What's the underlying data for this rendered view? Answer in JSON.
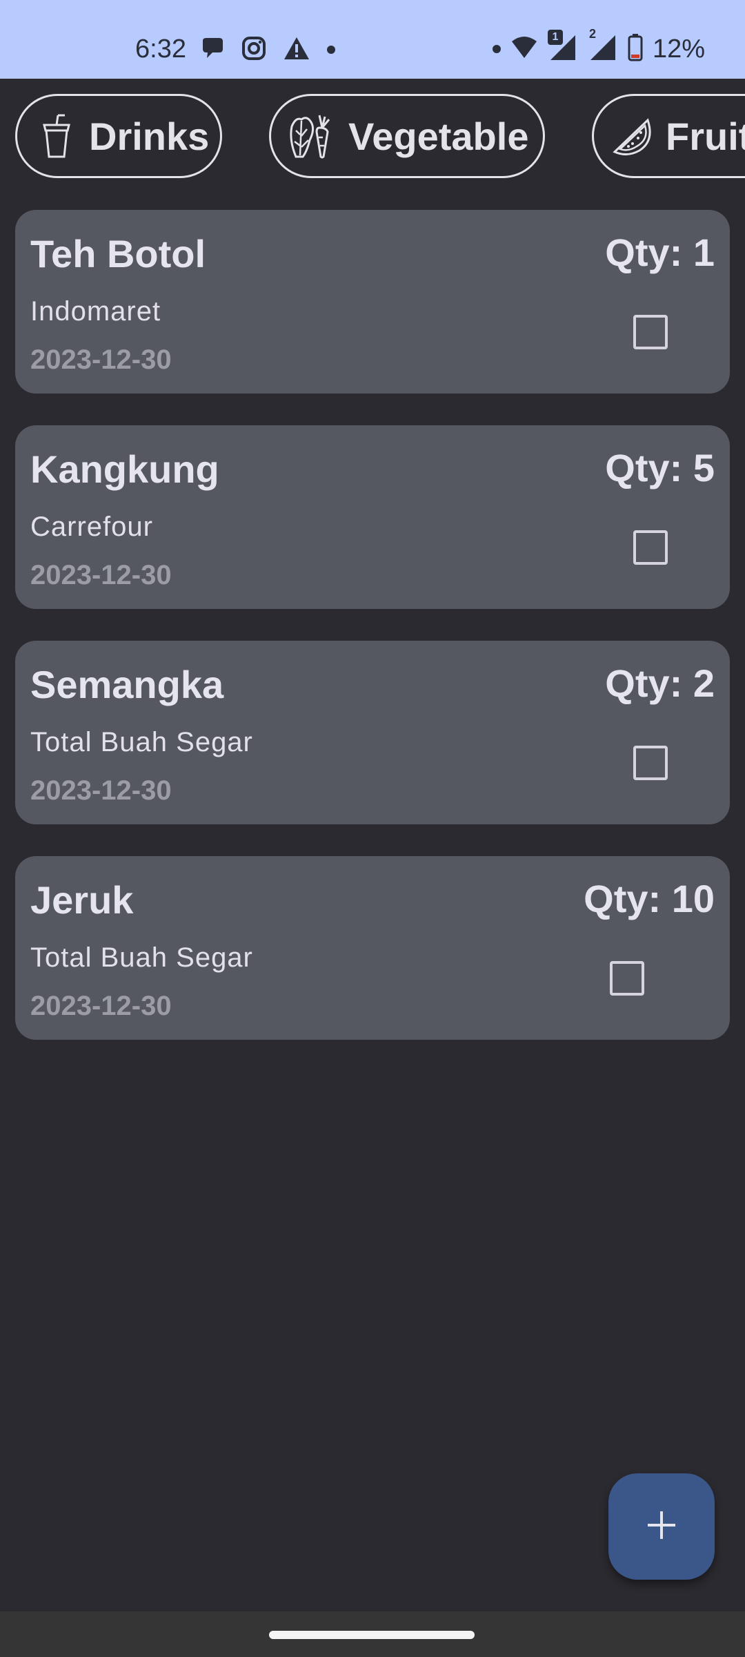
{
  "status_bar": {
    "time": "6:32",
    "battery": "12%",
    "sim_badge": "1",
    "sim2_label": "2",
    "icons": [
      "chat-bubble-icon",
      "instagram-icon",
      "warning-icon",
      "dot-icon",
      "dot-icon",
      "wifi-icon",
      "signal-icon",
      "signal-icon",
      "battery-icon"
    ]
  },
  "categories": [
    {
      "label": "Drinks",
      "icon": "drink-cup-icon"
    },
    {
      "label": "Vegetable",
      "icon": "vegetable-icon"
    },
    {
      "label": "Fruit",
      "icon": "watermelon-icon"
    }
  ],
  "items": [
    {
      "name": "Teh Botol",
      "store": "Indomaret",
      "date": "2023-12-30",
      "qty": "Qty: 1",
      "checked": false
    },
    {
      "name": "Kangkung",
      "store": "Carrefour",
      "date": "2023-12-30",
      "qty": "Qty: 5",
      "checked": false
    },
    {
      "name": "Semangka",
      "store": "Total Buah Segar",
      "date": "2023-12-30",
      "qty": "Qty: 2",
      "checked": false
    },
    {
      "name": "Jeruk",
      "store": "Total Buah Segar",
      "date": "2023-12-30",
      "qty": "Qty: 10",
      "checked": false
    }
  ],
  "fab": {
    "icon": "plus-icon"
  },
  "colors": {
    "status_bar_bg": "#b8cbfe",
    "background": "#2b2a30",
    "card_bg": "#555860",
    "fab_bg": "#3b5688",
    "text_primary": "#e6e4ec",
    "text_muted": "#9c9ca6"
  }
}
